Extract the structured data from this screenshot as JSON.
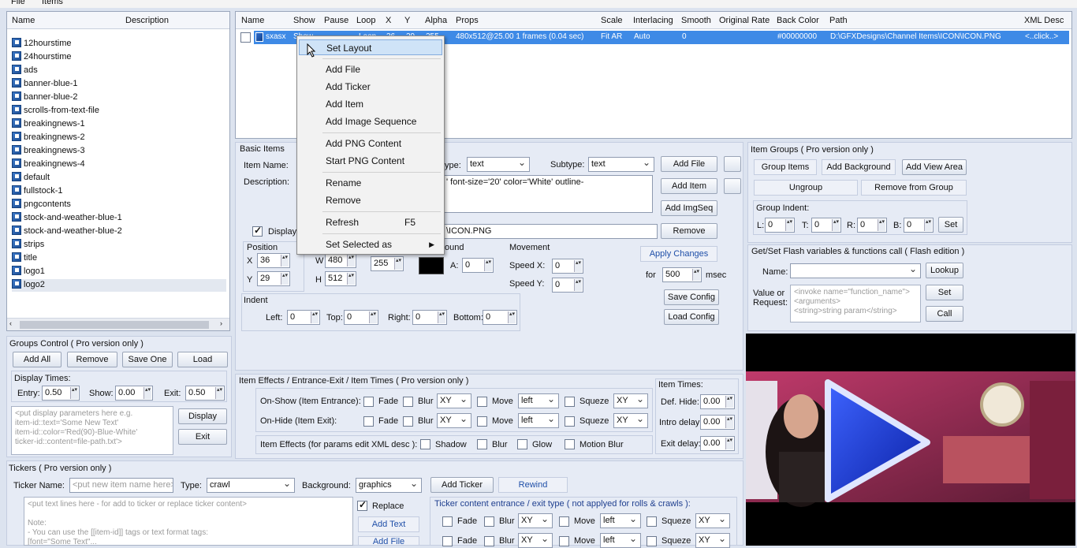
{
  "menu": {
    "file": "File",
    "items": "Items"
  },
  "left_list": {
    "col_name": "Name",
    "col_description": "Description",
    "items": [
      "12hourstime",
      "24hourstime",
      "ads",
      "banner-blue-1",
      "banner-blue-2",
      "scrolls-from-text-file",
      "breakingnews-1",
      "breakingnews-2",
      "breakingnews-3",
      "breakingnews-4",
      "default",
      "fullstock-1",
      "pngcontents",
      "stock-and-weather-blue-1",
      "stock-and-weather-blue-2",
      "strips",
      "title",
      "logo1",
      "logo2"
    ]
  },
  "grid": {
    "headers": [
      "Name",
      "Show",
      "Pause",
      "Loop",
      "X",
      "Y",
      "Alpha",
      "Props",
      "Scale",
      "Interlacing",
      "Smooth",
      "Original Rate",
      "Back Color",
      "Path",
      "XML Desc"
    ],
    "row": {
      "name": "sxasx",
      "show": "Show",
      "loop": "Loop",
      "x": "36",
      "y": "29",
      "alpha": "255",
      "props": "480x512@25.00 1 frames (0.04 sec)",
      "scale": "Fit AR",
      "interlacing": "Auto",
      "smooth": "0",
      "back_color": "#00000000",
      "path": "D:\\GFXDesigns\\Channel Items\\ICON\\ICON.PNG",
      "xml_desc": "<..click..>"
    }
  },
  "context_menu": {
    "set_layout": "Set Layout",
    "add_file": "Add File",
    "add_ticker": "Add Ticker",
    "add_item": "Add Item",
    "add_image_sequence": "Add Image Sequence",
    "add_png_content": "Add PNG Content",
    "start_png_content": "Start PNG Content",
    "rename": "Rename",
    "remove": "Remove",
    "refresh": "Refresh",
    "refresh_shortcut": "F5",
    "set_selected_as": "Set Selected as"
  },
  "basic_items": {
    "title": "Basic Items",
    "item_name_label": "Item Name:",
    "description_label": "Description:",
    "type_label": "ype:",
    "type_value": "text",
    "subtype_label": "Subtype:",
    "subtype_value": "text",
    "description_value": "' font-size='20' color='White' outline-",
    "path_value": "\\ICON.PNG",
    "display_label": "Display",
    "position_label": "Position",
    "x_label": "X",
    "x_value": "36",
    "y_label": "Y",
    "y_value": "29",
    "w_label": "W",
    "w_value": "480",
    "h_label": "H",
    "h_value": "512",
    "alpha_value": "255",
    "background_label": "ound",
    "a_label": "A:",
    "a_value": "0",
    "movement_label": "Movement",
    "speed_x_label": "Speed X:",
    "speed_x_value": "0",
    "speed_y_label": "Speed Y:",
    "speed_y_value": "0",
    "indent_label": "Indent",
    "left_label": "Left:",
    "left_value": "0",
    "top_label": "Top:",
    "top_value": "0",
    "right_label": "Right:",
    "right_value": "0",
    "bottom_label": "Bottom:",
    "bottom_value": "0",
    "add_file": "Add File",
    "add_item": "Add Item",
    "add_imgseq": "Add ImgSeq",
    "remove": "Remove",
    "apply_changes": "Apply Changes",
    "for_label": "for",
    "for_value": "500",
    "msec_label": "msec",
    "save_config": "Save Config",
    "load_config": "Load Config"
  },
  "item_groups": {
    "title": "Item Groups ( Pro version only )",
    "group_items": "Group Items",
    "add_background": "Add Background",
    "add_view_area": "Add View Area",
    "ungroup": "Ungroup",
    "remove_from_group": "Remove from Group",
    "group_indent": "Group Indent:",
    "l_label": "L:",
    "l_value": "0",
    "t_label": "T:",
    "t_value": "0",
    "r_label": "R:",
    "r_value": "0",
    "b_label": "B:",
    "b_value": "0",
    "set": "Set"
  },
  "flash": {
    "title": "Get/Set Flash variables & functions call ( Flash edition )",
    "name_label": "Name:",
    "lookup": "Lookup",
    "value_label": "Value or Request:",
    "value_placeholder": "<invoke name=\"function_name\">\n<arguments>\n<string>string param</string>",
    "set": "Set",
    "call": "Call"
  },
  "groups_control": {
    "title": "Groups Control ( Pro version only )",
    "add_all": "Add All",
    "remove": "Remove",
    "save_one": "Save One",
    "load": "Load",
    "display_times": "Display Times:",
    "entry_label": "Entry:",
    "entry_value": "0.50",
    "show_label": "Show:",
    "show_value": "0.00",
    "exit_label": "Exit:",
    "exit_value": "0.50",
    "params_placeholder": "<put display parameters here e.g.\nitem-id::text='Some New Text'\nitem-id::color='Red(90)-Blue-White'\nticker-id::content=file-path.txt'>",
    "display": "Display",
    "exit": "Exit"
  },
  "effects": {
    "title": "Item Effects / Entrance-Exit / Item Times ( Pro version only )",
    "on_show": "On-Show (Item Entrance):",
    "on_hide": "On-Hide (Item Exit):",
    "fade": "Fade",
    "blur": "Blur",
    "xy": "XY",
    "move": "Move",
    "left": "left",
    "squeze": "Squeze",
    "item_effects": "Item Effects (for params edit XML desc ):",
    "shadow": "Shadow",
    "glow": "Glow",
    "motion_blur": "Motion Blur",
    "item_times": "Item Times:",
    "def_hide": "Def. Hide:",
    "def_hide_value": "0.00",
    "intro_delay": "Intro delay:",
    "intro_delay_value": "0.00",
    "exit_delay": "Exit delay:",
    "exit_delay_value": "0.00"
  },
  "tickers": {
    "title": "Tickers ( Pro version only )",
    "ticker_name_label": "Ticker Name:",
    "ticker_name_placeholder": "<put new item name here>",
    "type_label": "Type:",
    "type_value": "crawl",
    "background_label": "Background:",
    "background_value": "graphics",
    "add_ticker": "Add Ticker",
    "rewind": "Rewind",
    "text_placeholder": "<put text lines here - for add to ticker or replace ticker content>\n\nNote:\n- You can use the [[item-id]] tags or text format tags:\n[font=\"Some Text\"...",
    "replace_label": "Replace",
    "add_text": "Add Text",
    "add_file": "Add File",
    "content_type_title": "Ticker content entrance / exit type ( not applyed for rolls & crawls ):",
    "fade": "Fade",
    "blur": "Blur",
    "xy": "XY",
    "move": "Move",
    "left": "left",
    "squeze": "Squeze"
  },
  "colors": {
    "selection": "#3e8ae6",
    "panel": "#eef1f8",
    "context_highlight": "#cfe3f7",
    "play_button": "#1a3fd6"
  }
}
